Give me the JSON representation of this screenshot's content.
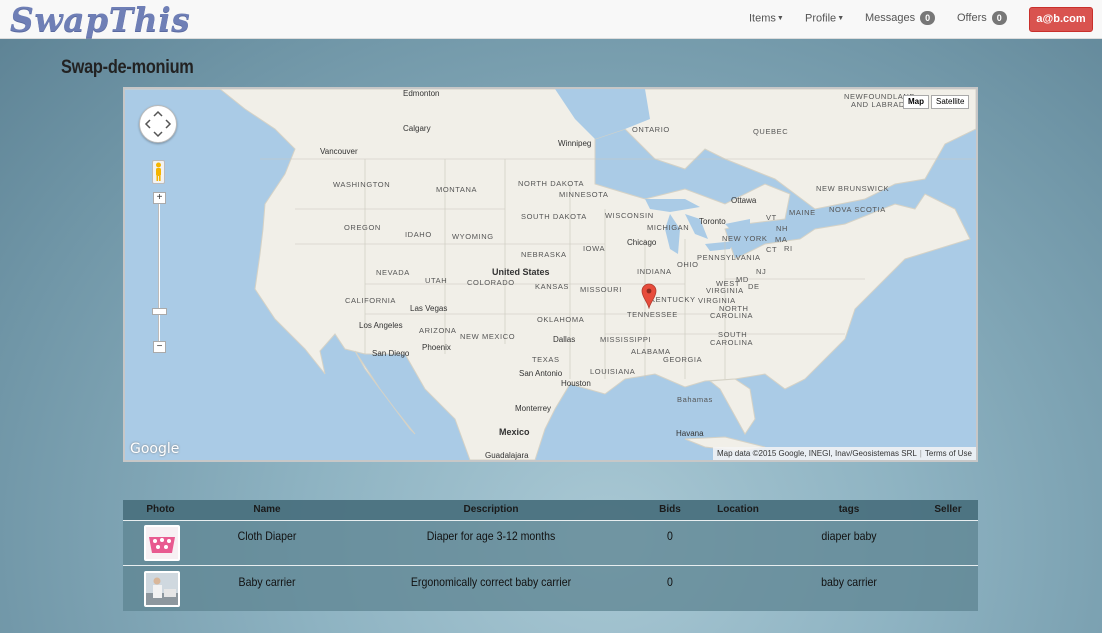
{
  "brand": "SwapThis",
  "nav": {
    "items": "Items",
    "profile": "Profile",
    "messages": "Messages",
    "messages_count": "0",
    "offers": "Offers",
    "offers_count": "0",
    "user": "a@b.com"
  },
  "page_title": "Swap-de-monium",
  "map": {
    "map_button": "Map",
    "satellite_button": "Satellite",
    "attribution": "Map data ©2015 Google, INEGI, Inav/Geosistemas SRL",
    "terms": "Terms of Use",
    "logo": "Google",
    "labels": {
      "newfoundland": "NEWFOUNDLAND",
      "labrador": "AND LABRADOR",
      "edmonton": "Edmonton",
      "calgary": "Calgary",
      "ontario": "ONTARIO",
      "quebec": "QUEBEC",
      "winnipeg": "Winnipeg",
      "vancouver": "Vancouver",
      "washington": "WASHINGTON",
      "montana": "MONTANA",
      "north_dakota": "NORTH DAKOTA",
      "minnesota": "MINNESOTA",
      "ottawa": "Ottawa",
      "new_brunswick": "NEW BRUNSWICK",
      "maine": "MAINE",
      "nova_scotia": "NOVA SCOTIA",
      "oregon": "OREGON",
      "idaho": "IDAHO",
      "wyoming": "WYOMING",
      "south_dakota": "SOUTH DAKOTA",
      "wisconsin": "WISCONSIN",
      "michigan": "MICHIGAN",
      "toronto": "Toronto",
      "new_york": "NEW YORK",
      "nebraska": "NEBRASKA",
      "iowa": "IOWA",
      "chicago": "Chicago",
      "ohio": "OHIO",
      "pennsylvania": "PENNSYLVANIA",
      "nevada": "NEVADA",
      "united_states": "United States",
      "utah": "UTAH",
      "colorado": "COLORADO",
      "kansas": "KANSAS",
      "missouri": "MISSOURI",
      "indiana": "INDIANA",
      "west": "WEST",
      "virginia_w": "VIRGINIA",
      "virginia": "VIRGINIA",
      "kentucky": "KENTUCKY",
      "california": "CALIFORNIA",
      "las_vegas": "Las Vegas",
      "tennessee": "TENNESSEE",
      "north_carolina_n": "NORTH",
      "north_carolina_c": "CAROLINA",
      "los_angeles": "Los Angeles",
      "arizona": "ARIZONA",
      "oklahoma": "OKLAHOMA",
      "phoenix": "Phoenix",
      "new_mexico": "NEW MEXICO",
      "dallas": "Dallas",
      "mississippi": "MISSISSIPPI",
      "south_carolina_s": "SOUTH",
      "south_carolina_c": "CAROLINA",
      "san_diego": "San Diego",
      "alabama": "ALABAMA",
      "georgia": "GEORGIA",
      "texas": "TEXAS",
      "san_antonio": "San Antonio",
      "louisiana": "LOUISIANA",
      "houston": "Houston",
      "monterrey": "Monterrey",
      "bahamas": "Bahamas",
      "mexico": "Mexico",
      "havana": "Havana",
      "guadalajara": "Guadalajara",
      "vt": "VT",
      "nh": "NH",
      "ma": "MA",
      "ct": "CT",
      "ri": "RI",
      "nj": "NJ",
      "md": "MD",
      "de": "DE"
    }
  },
  "table": {
    "headers": [
      "Photo",
      "Name",
      "Description",
      "Bids",
      "Location",
      "tags",
      "Seller"
    ],
    "rows": [
      {
        "name": "Cloth Diaper",
        "description": "Diaper for age 3-12 months",
        "bids": "0",
        "location": "",
        "tags": "diaper baby",
        "seller": "",
        "photo_icon": "diaper-photo"
      },
      {
        "name": "Baby carrier",
        "description": "Ergonomically correct baby carrier",
        "bids": "0",
        "location": "",
        "tags": "baby carrier",
        "seller": "",
        "photo_icon": "baby-carrier-photo"
      }
    ]
  },
  "colors": {
    "brand": "#6f7fb6",
    "user_button": "#d9534f",
    "map_water": "#aacbe6",
    "map_land": "#f1efe8",
    "pin": "#e74c3c"
  }
}
